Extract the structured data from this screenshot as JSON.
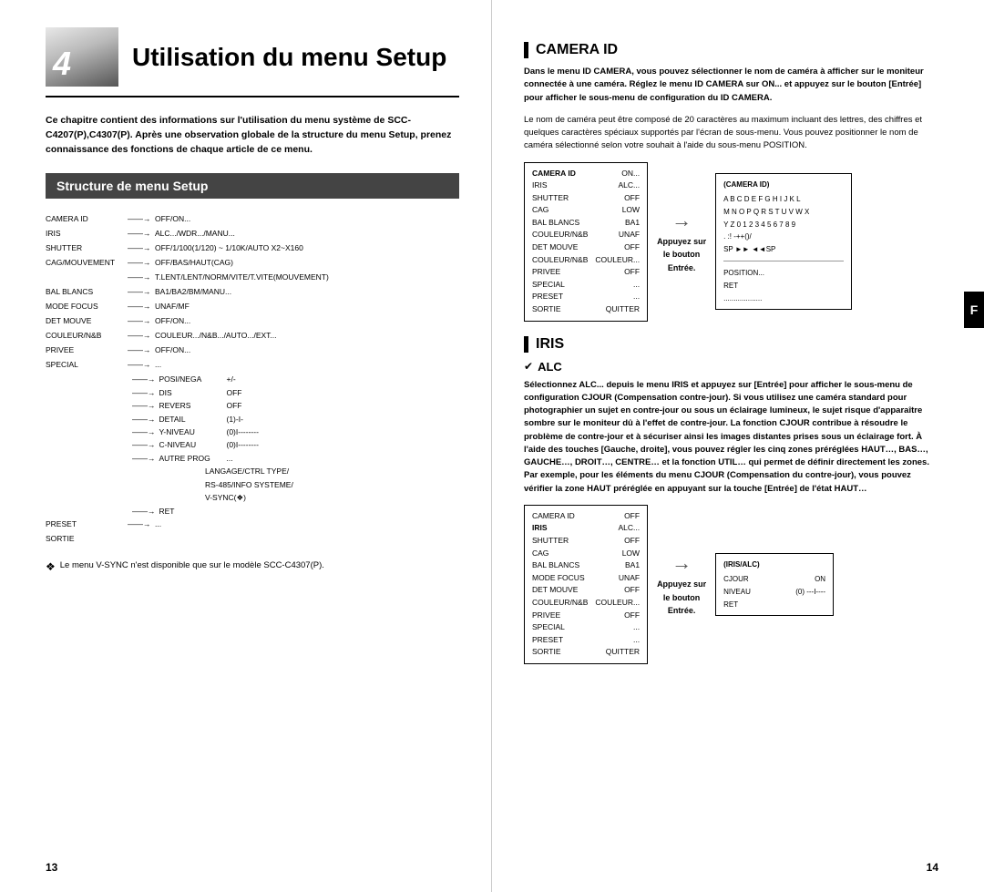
{
  "left": {
    "chapter_num": "4",
    "chapter_title": "Utilisation du menu Setup",
    "intro": "Ce chapitre contient des informations sur l'utilisation du menu système de SCC-C4207(P),C4307(P). Après une observation globale de la structure du menu Setup, prenez connaissance des fonctions de chaque article de ce menu.",
    "section_title": "Structure de menu Setup",
    "menu_items": [
      {
        "name": "CAMERA ID",
        "arrow": "→",
        "value": "OFF/ON..."
      },
      {
        "name": "IRIS",
        "arrow": "→",
        "value": "ALC.../WDR.../MANU..."
      },
      {
        "name": "SHUTTER",
        "arrow": "→",
        "value": "OFF/1/100(1/120) ~ 1/10K/AUTO X2~X160"
      },
      {
        "name": "CAG/MOUVEMENT",
        "arrow": "→",
        "value": "OFF/BAS/HAUT(CAG)"
      },
      {
        "name": "",
        "arrow": "→",
        "value": "T.LENT/LENT/NORM/VITE/T.VITE(MOUVEMENT)"
      },
      {
        "name": "BAL BLANCS",
        "arrow": "→",
        "value": "BA1/BA2/BM/MANU..."
      },
      {
        "name": "MODE FOCUS",
        "arrow": "→",
        "value": "UNAF/MF"
      },
      {
        "name": "DET MOUVE",
        "arrow": "→",
        "value": "OFF/ON..."
      },
      {
        "name": "COULEUR/N&B",
        "arrow": "→",
        "value": "COULEUR.../N&B.../AUTO.../EXT..."
      },
      {
        "name": "PRIVEE",
        "arrow": "→",
        "value": "OFF/ON..."
      },
      {
        "name": "SPECIAL",
        "arrow": "→",
        "value": "..."
      }
    ],
    "special_sub": [
      {
        "label": "POSI/NEGA",
        "value": "+/-"
      },
      {
        "label": "DIS",
        "value": "OFF"
      },
      {
        "label": "REVERS",
        "value": "OFF"
      },
      {
        "label": "DETAIL",
        "value": "(1)-I-"
      },
      {
        "label": "Y-NIVEAU",
        "value": "(0)I--------"
      },
      {
        "label": "C-NIVEAU",
        "value": "(0)I--------"
      },
      {
        "label": "AUTRE PROG",
        "value": "..."
      }
    ],
    "autre_prog_values": "LANGAGE/CTRL TYPE/\nRS-485/INFO SYSTEME/\nV-SYNC(❖)",
    "ret_label": "RET",
    "preset_item": {
      "name": "PRESET",
      "arrow": "→",
      "value": "..."
    },
    "sortie_item": {
      "name": "SORTIE",
      "value": ""
    },
    "note": "❖  Le menu V-SYNC n'est disponible que sur le modèle SCC-C4307(P).",
    "page_num": "13"
  },
  "right": {
    "camera_id_title": "CAMERA ID",
    "camera_id_intro_bold": "Dans le menu ID CAMERA, vous pouvez sélectionner le nom de caméra à afficher sur le moniteur connectée à une caméra. Réglez le menu ID CAMERA sur ON... et appuyez sur le bouton [Entrée] pour afficher le sous-menu de configuration du ID CAMERA.",
    "camera_id_text": "Le nom de caméra peut être composé de 20 caractères au maximum incluant des lettres, des chiffres et quelques caractères spéciaux supportés par l'écran de sous-menu. Vous pouvez positionner le nom de caméra sélectionné selon votre souhait à l'aide du sous-menu POSITION.",
    "panel1_title": "(CAMERA ID)",
    "panel1_rows": [
      {
        "left": "CAMERA ID",
        "right": "ON...",
        "selected": false
      },
      {
        "left": "IRIS",
        "right": "ALC...",
        "selected": false
      },
      {
        "left": "SHUTTER",
        "right": "OFF",
        "selected": false
      },
      {
        "left": "CAG",
        "right": "LOW",
        "selected": false
      },
      {
        "left": "BAL BLANCS",
        "right": "BA1",
        "selected": false
      },
      {
        "left": "COULEUR/N&B",
        "right": "UNAF",
        "selected": false
      },
      {
        "left": "DET MOUVE",
        "right": "OFF",
        "selected": false
      },
      {
        "left": "COULEUR/N&B",
        "right": "COULEUR...",
        "selected": false
      },
      {
        "left": "PRIVEE",
        "right": "OFF",
        "selected": false
      },
      {
        "left": "SPECIAL",
        "right": "...",
        "selected": false
      },
      {
        "left": "PRESET",
        "right": "...",
        "selected": false
      },
      {
        "left": "SORTIE",
        "right": "QUITTER",
        "selected": false
      }
    ],
    "appuyez_sur": "Appuyez sur",
    "le_bouton": "le bouton",
    "entree": "Entrée.",
    "panel2_title": "(CAMERA ID)",
    "panel2_chars": "A B C D E F G H I J K L\nM N O P Q R S T U V W X\nY Z 0 1 2 3 4 5 6 7 8 9\n. :! -++()/\nSP ►► ◄◄SP",
    "panel2_bottom": "POSITION...\nRET\n...................",
    "f_tab": "F",
    "iris_title": "IRIS",
    "alc_subtitle": "ALC",
    "alc_bold_text": "Sélectionnez ALC... depuis le menu IRIS et appuyez sur [Entrée] pour afficher le sous-menu de configuration CJOUR (Compensation contre-jour). Si vous utilisez une caméra standard pour photographier un sujet en contre-jour ou sous un éclairage lumineux, le sujet risque d'apparaître sombre sur le moniteur dû à l'effet de contre-jour. La fonction CJOUR contribue à résoudre le problème de contre-jour et à sécuriser ainsi les images distantes prises sous un éclairage fort. À l'aide des touches [Gauche, droite], vous pouvez régler les cinq zones préréglées HAUT…, BAS…, GAUCHE…, DROIT…, CENTRE… et la fonction UTIL… qui permet de définir directement les zones. Par exemple, pour les éléments du menu CJOUR (Compensation du contre-jour), vous pouvez vérifier la zone HAUT préréglée en appuyant sur la touche [Entrée] de l'état HAUT…",
    "panel3_rows": [
      {
        "left": "CAMERA ID",
        "right": "OFF"
      },
      {
        "left": "IRIS",
        "right": "ALC..."
      },
      {
        "left": "SHUTTER",
        "right": "OFF"
      },
      {
        "left": "CAG",
        "right": "LOW"
      },
      {
        "left": "BAL BLANCS",
        "right": "BA1"
      },
      {
        "left": "MODE FOCUS",
        "right": "UNAF"
      },
      {
        "left": "DET MOUVE",
        "right": "OFF"
      },
      {
        "left": "COULEUR/N&B",
        "right": "COULEUR..."
      },
      {
        "left": "PRIVEE",
        "right": "OFF"
      },
      {
        "left": "SPECIAL",
        "right": "..."
      },
      {
        "left": "PRESET",
        "right": "..."
      },
      {
        "left": "SORTIE",
        "right": "QUITTER"
      }
    ],
    "panel4_title": "(IRIS/ALC)",
    "panel4_rows": [
      {
        "left": "CJOUR",
        "right": "ON"
      },
      {
        "left": "NIVEAU",
        "right": "(0) ---I----"
      },
      {
        "left": "RET",
        "right": ""
      }
    ],
    "page_num": "14"
  }
}
